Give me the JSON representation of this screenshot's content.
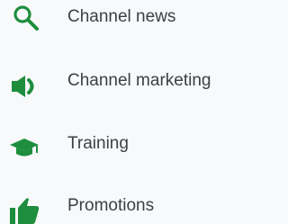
{
  "accent_color": "#1e8e3e",
  "text_color": "#3c4043",
  "menu": {
    "items": [
      {
        "label": "Channel news",
        "icon": "search-icon"
      },
      {
        "label": "Channel marketing",
        "icon": "megaphone-icon"
      },
      {
        "label": "Training",
        "icon": "graduation-cap-icon"
      },
      {
        "label": "Promotions",
        "icon": "thumbs-up-icon"
      }
    ]
  }
}
